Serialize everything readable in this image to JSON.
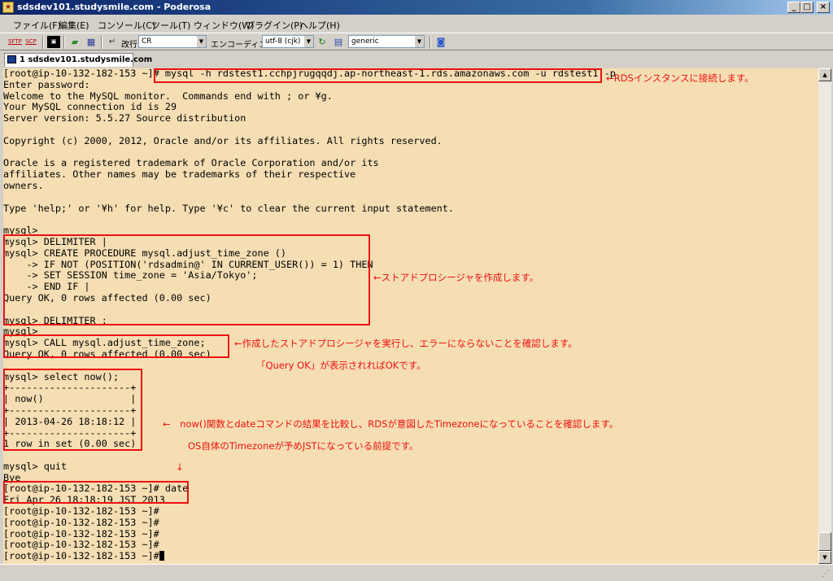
{
  "window": {
    "title": "sdsdev101.studysmile.com - Poderosa",
    "minimize_label": "_",
    "maximize_label": "□",
    "close_label": "×"
  },
  "menu": {
    "items": [
      "ファイル(F)",
      "編集(E)",
      "コンソール(C)",
      "ツール(T)",
      "ウィンドウ(W)",
      "プラグイン(P)",
      "ヘルプ(H)"
    ]
  },
  "toolbar": {
    "sftp_label": "SFTP",
    "scp_label": "SCP",
    "newline_label": "改行",
    "newline_value": "CR",
    "encoding_label": "エンコーディング",
    "encoding_value": "utf-8 (cjk)",
    "terminal_type_value": "generic"
  },
  "tab": {
    "label": "1 sdsdev101.studysmile.com"
  },
  "terminal": {
    "lines": [
      "[root@ip-10-132-182-153 ~]# mysql -h rdstest1.cchpjrugqqdj.ap-northeast-1.rds.amazonaws.com -u rdstest1 -p",
      "Enter password:",
      "Welcome to the MySQL monitor.  Commands end with ; or ¥g.",
      "Your MySQL connection id is 29",
      "Server version: 5.5.27 Source distribution",
      "",
      "Copyright (c) 2000, 2012, Oracle and/or its affiliates. All rights reserved.",
      "",
      "Oracle is a registered trademark of Oracle Corporation and/or its",
      "affiliates. Other names may be trademarks of their respective",
      "owners.",
      "",
      "Type 'help;' or '¥h' for help. Type '¥c' to clear the current input statement.",
      "",
      "mysql>",
      "mysql> DELIMITER |",
      "mysql> CREATE PROCEDURE mysql.adjust_time_zone ()",
      "    -> IF NOT (POSITION('rdsadmin@' IN CURRENT_USER()) = 1) THEN",
      "    -> SET SESSION time_zone = 'Asia/Tokyo';",
      "    -> END IF |",
      "Query OK, 0 rows affected (0.00 sec)",
      "",
      "mysql> DELIMITER ;",
      "mysql>",
      "mysql> CALL mysql.adjust_time_zone;",
      "Query OK, 0 rows affected (0.00 sec)",
      "",
      "mysql> select now();",
      "+---------------------+",
      "| now()               |",
      "+---------------------+",
      "| 2013-04-26 18:18:12 |",
      "+---------------------+",
      "1 row in set (0.00 sec)",
      "",
      "mysql> quit",
      "Bye",
      "[root@ip-10-132-182-153 ~]# date",
      "Fri Apr 26 18:18:19 JST 2013",
      "[root@ip-10-132-182-153 ~]#",
      "[root@ip-10-132-182-153 ~]#",
      "[root@ip-10-132-182-153 ~]#",
      "[root@ip-10-132-182-153 ~]#",
      "[root@ip-10-132-182-153 ~]#"
    ]
  },
  "annotations": {
    "connect_note": "←RDSインスタンスに接続します。",
    "procedure_note": "←ストアドプロシージャを作成します。",
    "call_note": "←作成したストアドプロシージャを実行し、エラーにならないことを確認します。",
    "query_ok_note": "「Query OK」が表示されればOKです。",
    "compare_note": "←　now()関数とdateコマンドの結果を比較し、RDSが意図したTimezoneになっていることを確認します。",
    "os_note": "OS自体のTimezoneが予めJSTになっている前提です。",
    "down_arrow": "↓"
  },
  "colors": {
    "terminal_bg": "#f5deb3",
    "annotation_red": "#ee1111"
  }
}
